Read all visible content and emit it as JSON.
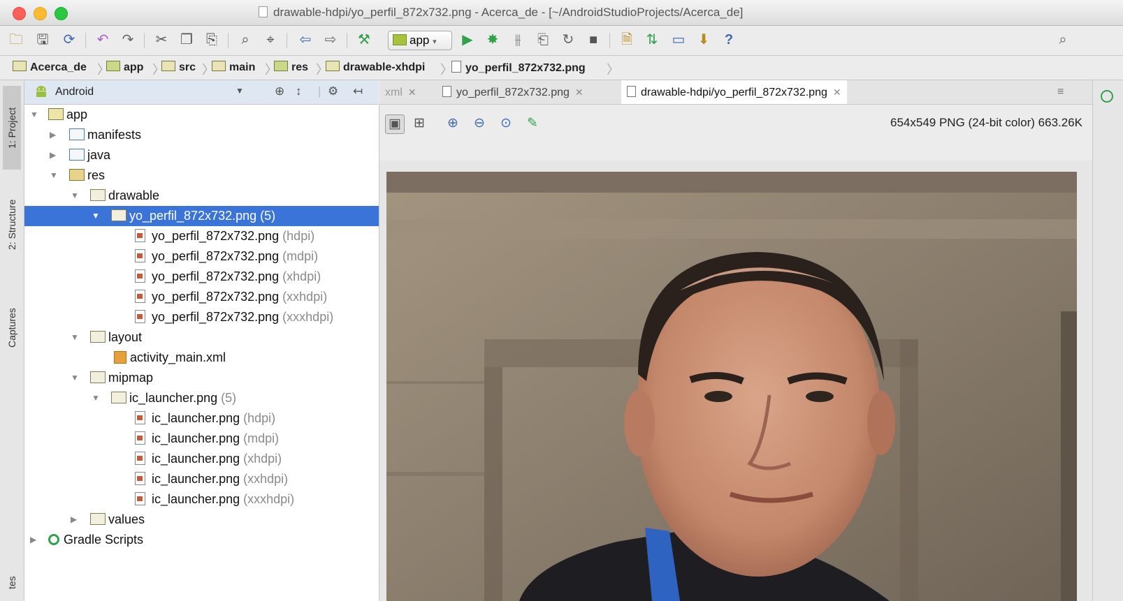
{
  "window": {
    "title": "drawable-hdpi/yo_perfil_872x732.png - Acerca_de - [~/AndroidStudioProjects/Acerca_de]"
  },
  "toolbar": {
    "run_config": "app",
    "help": "?"
  },
  "breadcrumb": [
    "Acerca_de",
    "app",
    "src",
    "main",
    "res",
    "drawable-xhdpi",
    "yo_perfil_872x732.png"
  ],
  "tool_windows": {
    "left": [
      "1: Project",
      "2: Structure",
      "Captures",
      "tes"
    ]
  },
  "project_panel": {
    "view_selector": "Android"
  },
  "tree": [
    {
      "label": "app",
      "qual": ""
    },
    {
      "label": "manifests",
      "qual": ""
    },
    {
      "label": "java",
      "qual": ""
    },
    {
      "label": "res",
      "qual": ""
    },
    {
      "label": "drawable",
      "qual": ""
    },
    {
      "label": "yo_perfil_872x732.png (5)",
      "qual": ""
    },
    {
      "label": "yo_perfil_872x732.png",
      "qual": "(hdpi)"
    },
    {
      "label": "yo_perfil_872x732.png",
      "qual": "(mdpi)"
    },
    {
      "label": "yo_perfil_872x732.png",
      "qual": "(xhdpi)"
    },
    {
      "label": "yo_perfil_872x732.png",
      "qual": "(xxhdpi)"
    },
    {
      "label": "yo_perfil_872x732.png",
      "qual": "(xxxhdpi)"
    },
    {
      "label": "layout",
      "qual": ""
    },
    {
      "label": "activity_main.xml",
      "qual": ""
    },
    {
      "label": "mipmap",
      "qual": ""
    },
    {
      "label": "ic_launcher.png",
      "qual": "(5)"
    },
    {
      "label": "ic_launcher.png",
      "qual": "(hdpi)"
    },
    {
      "label": "ic_launcher.png",
      "qual": "(mdpi)"
    },
    {
      "label": "ic_launcher.png",
      "qual": "(xhdpi)"
    },
    {
      "label": "ic_launcher.png",
      "qual": "(xxhdpi)"
    },
    {
      "label": "ic_launcher.png",
      "qual": "(xxxhdpi)"
    },
    {
      "label": "values",
      "qual": ""
    },
    {
      "label": "Gradle Scripts",
      "qual": ""
    }
  ],
  "editor_tabs": [
    {
      "label": "xml"
    },
    {
      "label": "yo_perfil_872x732.png"
    },
    {
      "label": "drawable-hdpi/yo_perfil_872x732.png"
    }
  ],
  "image_viewer": {
    "info": "654x549 PNG (24-bit color) 663.26K"
  },
  "colors": {
    "selection": "#3a74d9",
    "run_green": "#2fa24a"
  }
}
